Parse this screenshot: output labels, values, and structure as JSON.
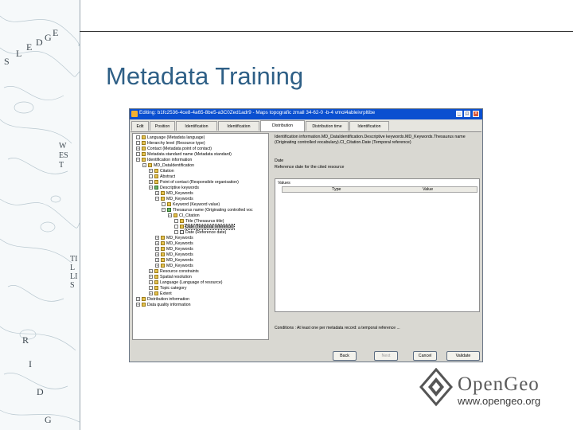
{
  "slide": {
    "title": "Metadata Training"
  },
  "map_text": {
    "ledge": [
      "S",
      "L",
      "E",
      "D",
      "G",
      "E"
    ],
    "west": "WEST",
    "tillis": "TILLIS",
    "ridge": [
      "R",
      "I",
      "D",
      "G"
    ]
  },
  "window": {
    "title": "Editing: b1fc2536-4ce8-4a65-8be5-a3C0Zed1adr9 - Maps topografic zmall 34-62-0 -b-4 vmol4ableivrpltibe",
    "buttons": [
      "_",
      "□",
      "×"
    ]
  },
  "tabs": [
    "Edit",
    "Position",
    "Identification",
    "Identification",
    "Distribution",
    "Distribution time",
    "Identification"
  ],
  "tree": [
    "Language (Metadata language)",
    "Hierarchy level (Resource type)",
    "Contact (Metadata point of contact)",
    "Metadata standard name (Metadata standard)",
    "Identification information",
    "MD_DataIdentification",
    "Citation",
    "Abstract",
    "Point of contact (Responsible organisation)",
    "Descriptive keywords",
    "MD_Keywords",
    "MD_Keywords",
    "Keyword (Keyword value)",
    "Thesaurus name (Originating controlled voc",
    "CI_Citation",
    "Title (Thesaurus title)",
    "Date (Temporal reference)",
    "Date (Reference date)",
    "MD_Keywords",
    "MD_Keywords",
    "MD_Keywords",
    "MD_Keywords",
    "MD_Keywords",
    "MD_Keywords",
    "Resource constraints",
    "Spatial resolution",
    "Language (Language of resource)",
    "Topic category",
    "Extent",
    "Distribution information",
    "Data quality information"
  ],
  "detail": {
    "description": "Identification information.MD_DataIdentification.Descriptive keywords.MD_Keywords.Thesaurus name (Originating controlled vocabulary).CI_Citation.Date (Temporal reference)",
    "field_label": "Date",
    "field_hint": "Reference date for the cited resource",
    "values_label": "Values",
    "columns": [
      "Type",
      "Value"
    ],
    "conditions": "Conditions : At least one per metadata record: a temporal reference ..."
  },
  "actions": {
    "back": "Back",
    "next": "Next",
    "cancel": "Cancel",
    "validate": "Validate"
  },
  "logo": {
    "name": "OpenGeo",
    "url": "www.opengeo.org"
  },
  "colors": {
    "title": "#2e5f86",
    "titlebar": "#0a4fd0"
  }
}
